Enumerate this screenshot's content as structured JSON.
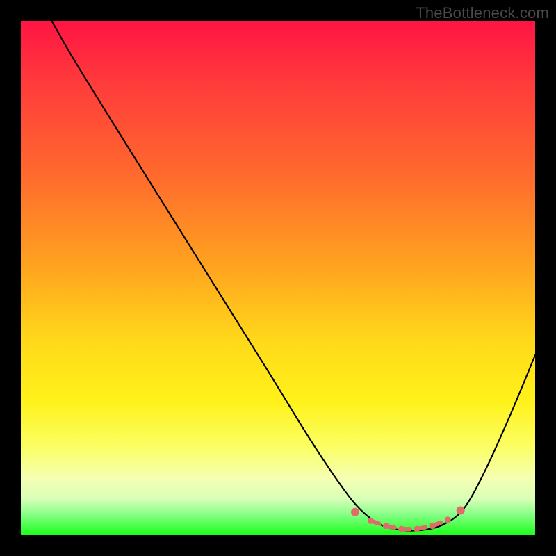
{
  "watermark": "TheBottleneck.com",
  "chart_data": {
    "type": "line",
    "title": "",
    "xlabel": "",
    "ylabel": "",
    "xlim": [
      0,
      100
    ],
    "ylim": [
      0,
      100
    ],
    "grid": false,
    "curve": [
      {
        "x": 6,
        "y": 100
      },
      {
        "x": 10,
        "y": 93
      },
      {
        "x": 18,
        "y": 80
      },
      {
        "x": 28,
        "y": 64
      },
      {
        "x": 38,
        "y": 48
      },
      {
        "x": 48,
        "y": 32
      },
      {
        "x": 56,
        "y": 19
      },
      {
        "x": 62,
        "y": 10
      },
      {
        "x": 66,
        "y": 5
      },
      {
        "x": 70,
        "y": 2
      },
      {
        "x": 74,
        "y": 1
      },
      {
        "x": 78,
        "y": 1
      },
      {
        "x": 82,
        "y": 2
      },
      {
        "x": 86,
        "y": 5
      },
      {
        "x": 90,
        "y": 12
      },
      {
        "x": 95,
        "y": 23
      },
      {
        "x": 100,
        "y": 35
      }
    ],
    "markers": [
      {
        "x": 65,
        "y": 4.5
      },
      {
        "x": 68,
        "y": 2.8
      },
      {
        "x": 71,
        "y": 1.8
      },
      {
        "x": 74,
        "y": 1.2
      },
      {
        "x": 77,
        "y": 1.2
      },
      {
        "x": 80,
        "y": 1.8
      },
      {
        "x": 83,
        "y": 3.0
      },
      {
        "x": 85.5,
        "y": 4.8
      }
    ],
    "background_gradient_stops": [
      {
        "pos": 0,
        "color": "#ff1444"
      },
      {
        "pos": 30,
        "color": "#ff6a2d"
      },
      {
        "pos": 62,
        "color": "#ffd81a"
      },
      {
        "pos": 89,
        "color": "#f5ffb3"
      },
      {
        "pos": 100,
        "color": "#1aff1a"
      }
    ]
  }
}
